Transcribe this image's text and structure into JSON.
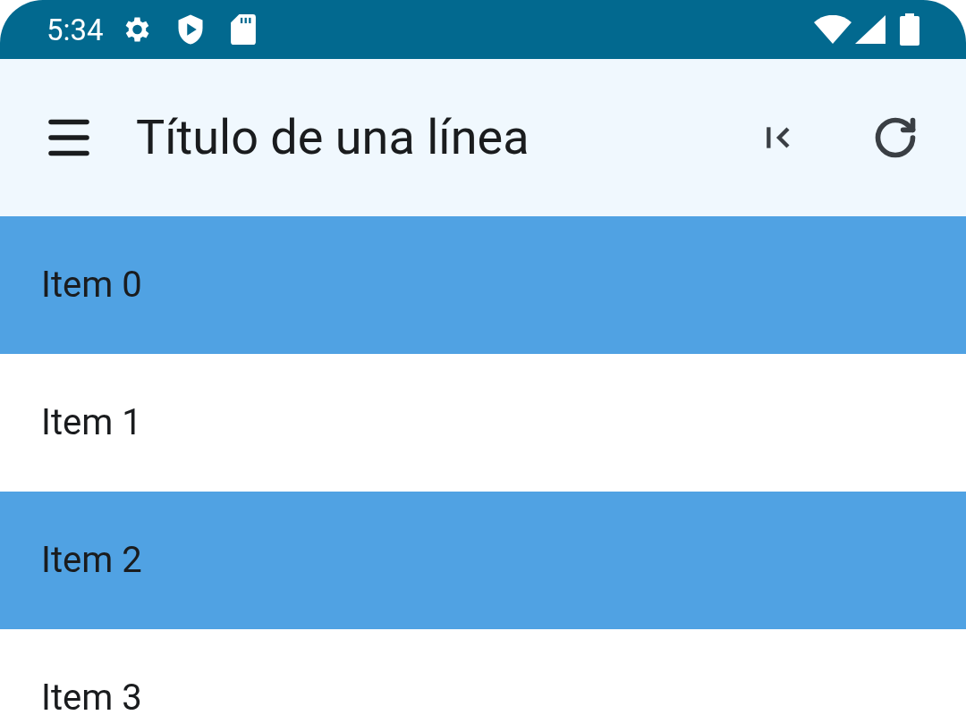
{
  "status_bar": {
    "time": "5:34"
  },
  "app_bar": {
    "title": "Título de una línea"
  },
  "items": [
    {
      "label": "Item 0",
      "selected": true
    },
    {
      "label": "Item 1",
      "selected": false
    },
    {
      "label": "Item 2",
      "selected": true
    },
    {
      "label": "Item 3",
      "selected": false
    }
  ]
}
